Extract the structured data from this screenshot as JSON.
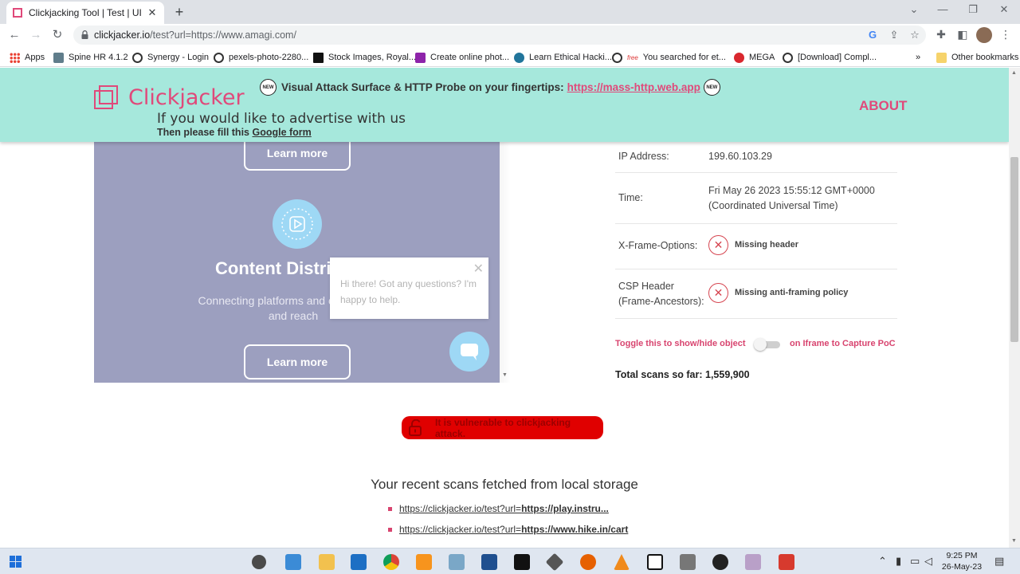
{
  "browser": {
    "tab_title": "Clickjacking Tool | Test | UI Redre",
    "tab_close": "✕",
    "new_tab": "+",
    "url_host": "clickjacker.io",
    "url_rest": "/test?url=https://www.amagi.com/",
    "bookmarks": [
      {
        "label": "Apps",
        "color": "#4285f4"
      },
      {
        "label": "Spine HR 4.1.2",
        "color": "#607d8b"
      },
      {
        "label": "Synergy - Login",
        "color": "#333333"
      },
      {
        "label": "pexels-photo-2280...",
        "color": "#333333"
      },
      {
        "label": "Stock Images, Royal...",
        "color": "#111111"
      },
      {
        "label": "Create online phot...",
        "color": "#8e24aa"
      },
      {
        "label": "Learn Ethical Hacki...",
        "color": "#21759b"
      },
      {
        "label": "You searched for et...",
        "color": "#333333"
      },
      {
        "label": "MEGA",
        "color": "#d9272e"
      },
      {
        "label": "[Download] Compl...",
        "color": "#333333"
      }
    ],
    "bookmarks_more": "»",
    "other_bookmarks": "Other bookmarks"
  },
  "header": {
    "logo": "Clickjacker",
    "new_badge": "NEW",
    "promo_text": "Visual Attack Surface & HTTP Probe on your fingertips:",
    "promo_link": "https://mass-http.web.app",
    "advertise_title": "If you would like to advertise with us",
    "advertise_sub": "Then please fill this",
    "advertise_link": "Google form",
    "about": "ABOUT"
  },
  "preview": {
    "learn_more_top": "Learn more",
    "heading": "Content Distri",
    "text": "Connecting platforms and content ow... and reach",
    "text_line1": "Connecting platforms and content own",
    "text_line2": "and reach",
    "learn_more_bottom": "Learn more",
    "chat_message": "Hi there! Got any questions? I'm happy to help.",
    "chat_close": "✕"
  },
  "results": {
    "ip_label": "IP Address:",
    "ip_value": "199.60.103.29",
    "time_label": "Time:",
    "time_value_line1": "Fri May 26 2023 15:55:12 GMT+0000",
    "time_value_line2": "(Coordinated Universal Time)",
    "xfo_label": "X-Frame-Options:",
    "xfo_value": "Missing header",
    "csp_label_line1": "CSP Header",
    "csp_label_line2": "(Frame-Ancestors):",
    "csp_value": "Missing anti-framing policy",
    "fail_mark": "✕",
    "toggle_label_left": "Toggle this to show/hide object",
    "toggle_label_right": "on Iframe to Capture PoC",
    "toggle_on": false,
    "total_scans": "Total scans so far: 1,559,900"
  },
  "verdict": {
    "text": "It is vulnerable to clickjacking attack.",
    "color": "#e00000"
  },
  "recent": {
    "title": "Your recent scans fetched from local storage",
    "items": [
      {
        "prefix": "https://clickjacker.io/test?url=",
        "target": "https://play.instru..."
      },
      {
        "prefix": "https://clickjacker.io/test?url=",
        "target": "https://www.hike.in/cart"
      }
    ]
  },
  "taskbar": {
    "time": "9:25 PM",
    "date": "26-May-23"
  },
  "colors": {
    "accent_pink": "#e0497a",
    "header_bg": "#a6e8dc",
    "preview_bg": "#9c9fbf"
  }
}
